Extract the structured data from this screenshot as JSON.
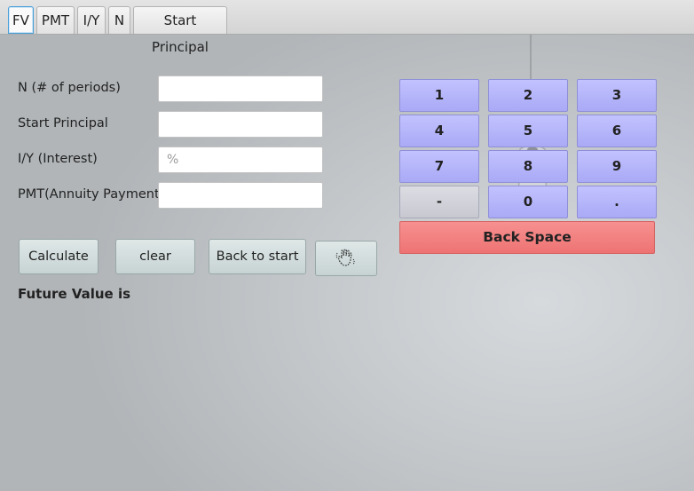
{
  "tabs": [
    {
      "label": "FV",
      "active": true
    },
    {
      "label": "PMT"
    },
    {
      "label": "I/Y"
    },
    {
      "label": "N"
    },
    {
      "label": "Start Principal"
    }
  ],
  "form": {
    "n_label": "N (# of periods)",
    "n_value": "",
    "principal_label": "Start Principal",
    "principal_value": "",
    "iy_label": "I/Y (Interest)",
    "iy_value": "",
    "iy_placeholder": "%",
    "pmt_label": "PMT(Annuity Payment)",
    "pmt_value": ""
  },
  "buttons": {
    "calculate": "Calculate",
    "clear": "clear",
    "back_to_start": "Back to start",
    "gesture_icon": "hand-wave-icon"
  },
  "result": {
    "label": "Future Value is",
    "value": ""
  },
  "keypad": {
    "keys": [
      "1",
      "2",
      "3",
      "4",
      "5",
      "6",
      "7",
      "8",
      "9",
      "-",
      "0",
      "."
    ],
    "backspace": "Back Space",
    "key_color": "#b4b4fa",
    "minus_key_color": "#d1d1d9",
    "backspace_color": "#f28080"
  }
}
